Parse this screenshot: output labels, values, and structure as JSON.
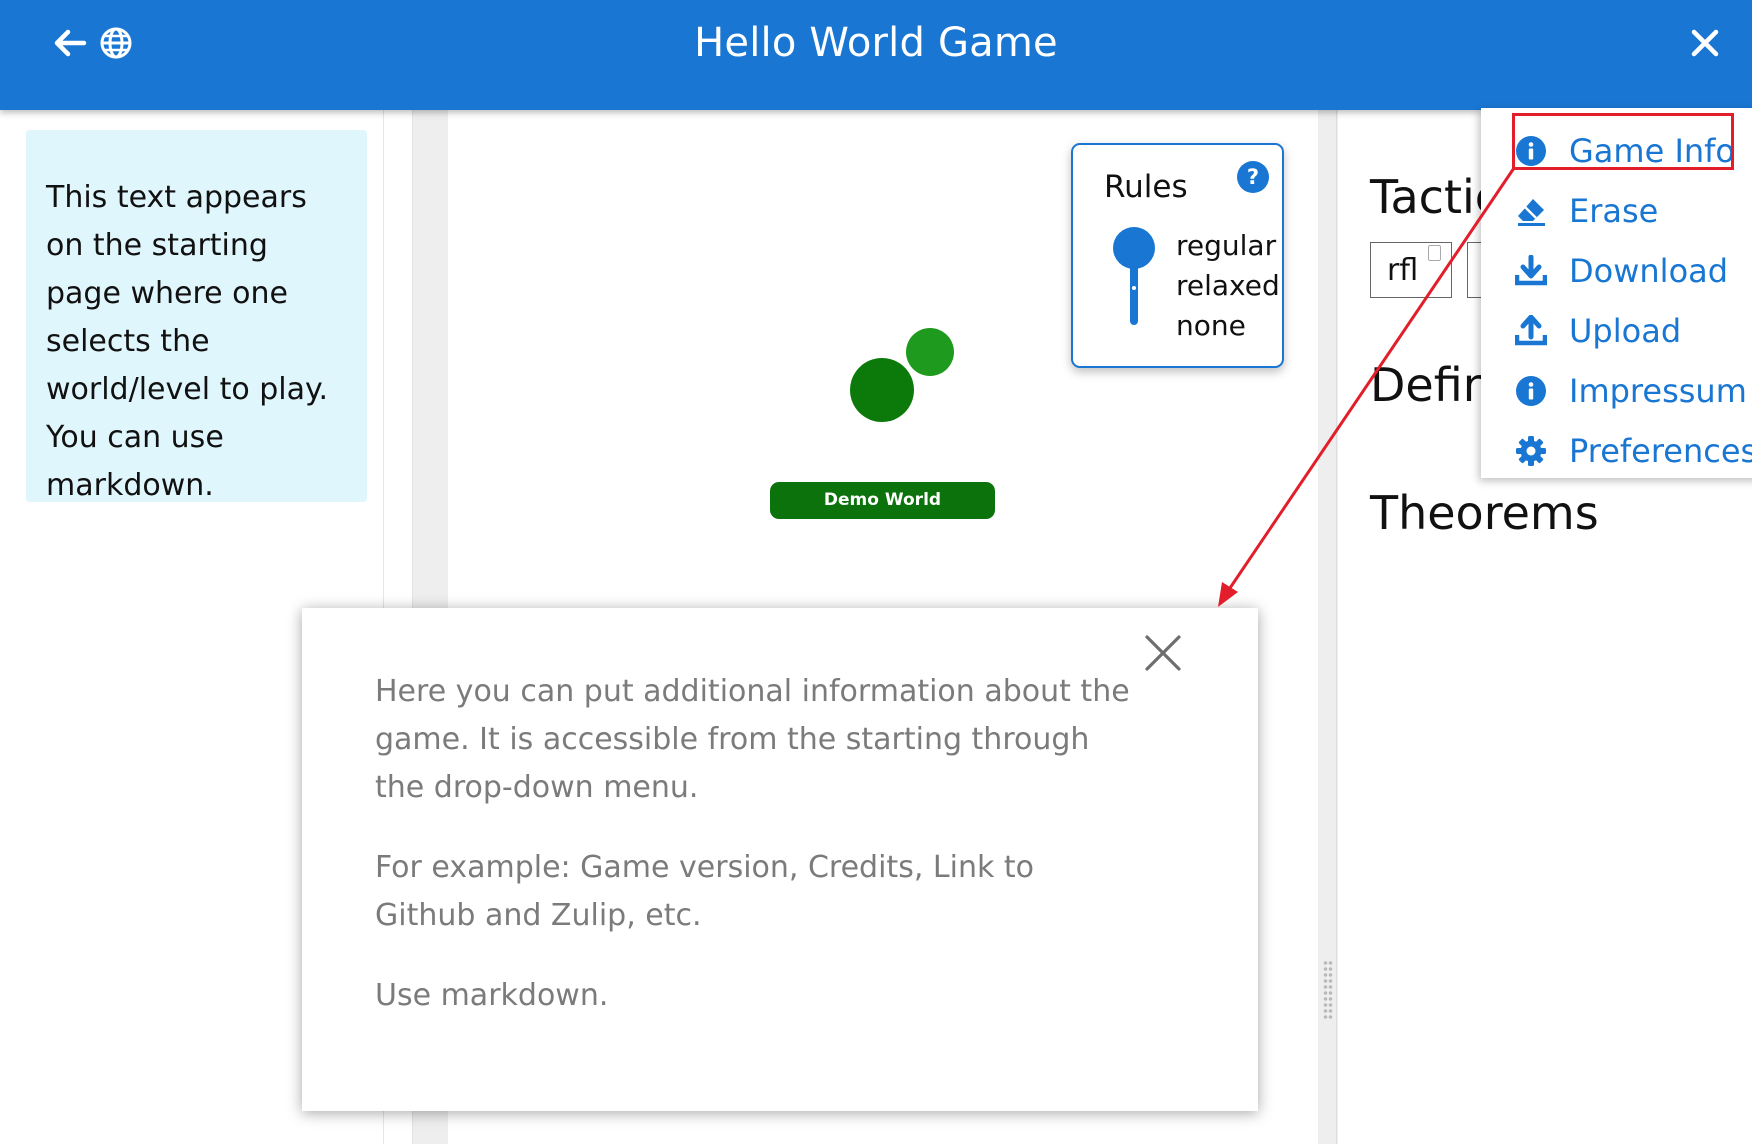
{
  "header": {
    "title": "Hello World Game",
    "back_icon": "arrow-left-icon",
    "language_icon": "globe-icon",
    "close_icon": "close-icon"
  },
  "intro": {
    "text": "This text appears on the starting page where one selects the world/level to play. You can use markdown."
  },
  "rules": {
    "title": "Rules",
    "help_label": "?",
    "options": [
      "regular",
      "relaxed",
      "none"
    ],
    "selected": "regular"
  },
  "world_map": {
    "label": "Demo World"
  },
  "inventory": {
    "tactics_heading": "Tactic",
    "tactic": "rfl",
    "definitions_heading": "Defin",
    "theorems_heading": "Theorems"
  },
  "menu": {
    "items": [
      {
        "label": "Game Info",
        "icon": "info-icon"
      },
      {
        "label": "Erase",
        "icon": "eraser-icon"
      },
      {
        "label": "Download",
        "icon": "download-icon"
      },
      {
        "label": "Upload",
        "icon": "upload-icon"
      },
      {
        "label": "Impressum",
        "icon": "info-icon"
      },
      {
        "label": "Preferences",
        "icon": "gear-icon"
      }
    ]
  },
  "modal": {
    "paragraphs": [
      "Here you can put additional information about the game. It is accessible from the starting through the drop-down menu.",
      "For example: Game version, Credits, Link to Github and Zulip, etc.",
      "Use markdown."
    ]
  },
  "colors": {
    "primary": "#1976d2",
    "world_node": "#0b7a0b",
    "world_node_light": "#1e9a1e",
    "annotation_red": "#e31e2b",
    "intro_bg": "#dff6fd"
  }
}
